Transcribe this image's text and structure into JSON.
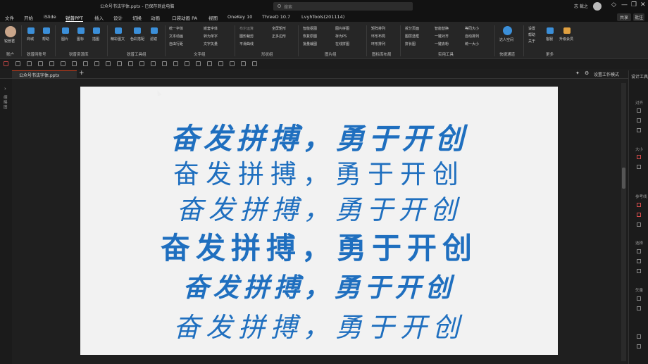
{
  "titlebar": {
    "title": "公众号书法字体.pptx - 已保存到此电脑",
    "search_placeholder": "搜索",
    "user": "志 裁之",
    "controls": [
      "—",
      "❐",
      "✕"
    ]
  },
  "ribbon_tabs": [
    "文件",
    "开始",
    "iSlide",
    "锐普PPT",
    "插入",
    "设计",
    "切换",
    "动画",
    "口袋动画 PA",
    "视图",
    "OneKey 10",
    "ThreeD 10.7",
    "LvyhTools(201114)"
  ],
  "ribbon_right": {
    "share": "共享",
    "comment": "批注"
  },
  "ribbon_groups": [
    {
      "label": "账户",
      "items": [
        "锐普君"
      ]
    },
    {
      "label": "锐普网账号",
      "items": [
        "商城",
        "帮助"
      ]
    },
    {
      "label": "锐普资源库",
      "items": [
        "图片",
        "图标",
        "插图"
      ]
    },
    {
      "label": "锐普工具组",
      "items": [
        "精彩图文",
        "色彩搭配",
        "滤镜"
      ]
    },
    {
      "label": "文字组",
      "items": [
        "统一字体",
        "文本动画",
        "自由行距",
        "嵌套字体",
        "转为单字",
        "文字矢量"
      ]
    },
    {
      "label": "形状组",
      "items": [
        "布尔运算",
        "图形裁剪",
        "平滑曲线",
        "全屏矩形",
        "正多边形"
      ]
    },
    {
      "label": "图片组",
      "items": [
        "智能抠图",
        "恢复原图",
        "批量裁图",
        "图片拼图",
        "存为PS",
        "在线拼图"
      ]
    },
    {
      "label": "图标库布局",
      "items": [
        "矩阵排列",
        "环形布局",
        "环形排列"
      ]
    },
    {
      "label": "实用工具",
      "items": [
        "拆分页面",
        "图层选框",
        "拼长图",
        "智能替换",
        "一键对齐",
        "一键去粉",
        "等同大小",
        "自动排列",
        "统一大小"
      ]
    },
    {
      "label": "快捷通道",
      "items": [
        "达人空间"
      ]
    },
    {
      "label": "更多",
      "items": [
        "设置",
        "帮助",
        "关于",
        "客服",
        "升级会员"
      ]
    }
  ],
  "doc_tab": "公众号书法字体.pptx",
  "slide": {
    "lines": [
      {
        "text": "奋发拼搏，勇于开创",
        "color": "#1f6fbf"
      },
      {
        "text": "奋发拼搏，勇于开创",
        "color": "#1f6fbf"
      },
      {
        "text": "奋发拼搏，勇于开创",
        "color": "#1f6fbf"
      },
      {
        "text": "奋发拼搏，勇于开创",
        "color": "#1f6fbf"
      },
      {
        "text": "奋发拼搏，勇于开创",
        "color": "#1f6fbf"
      },
      {
        "text": "奋发拼搏，勇于开创",
        "color": "#1f6fbf"
      }
    ]
  },
  "canvas_toolbar": {
    "label": "设置工作模式"
  },
  "right_panel": {
    "title": "设计工具",
    "labels": [
      "对齐",
      "大小",
      "参考线",
      "选择",
      "矢量"
    ]
  },
  "left_rail": {
    "label": "缩略图"
  }
}
